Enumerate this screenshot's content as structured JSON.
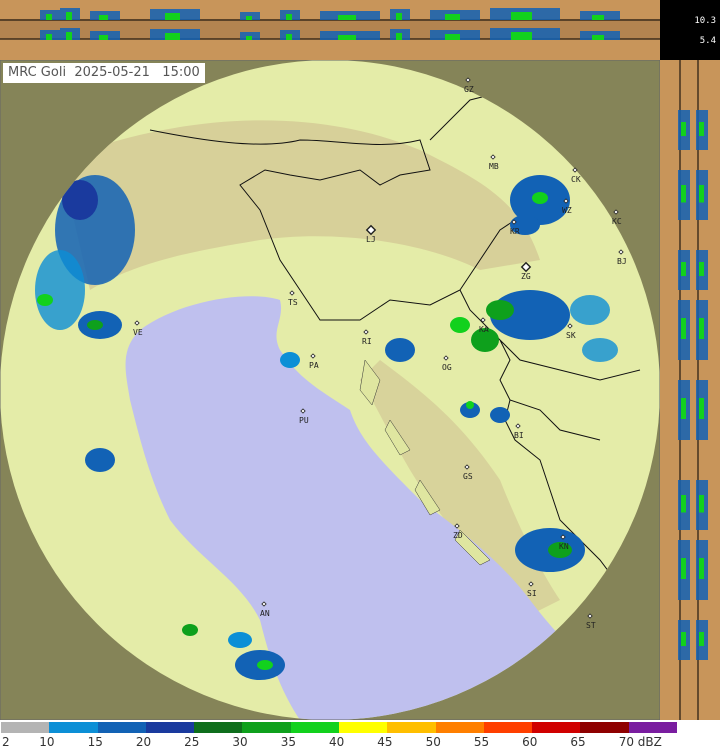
{
  "title": {
    "station": "MRC Goli",
    "date": "2025-05-21",
    "time": "15:00"
  },
  "corner_values": [
    "10.3",
    "5.4"
  ],
  "cities": [
    {
      "code": "GZ"
    },
    {
      "code": "MB"
    },
    {
      "code": "CK"
    },
    {
      "code": "WZ"
    },
    {
      "code": "KR"
    },
    {
      "code": "KC"
    },
    {
      "code": "LJ",
      "major": true
    },
    {
      "code": "BJ"
    },
    {
      "code": "ZG",
      "major": true
    },
    {
      "code": "TS"
    },
    {
      "code": "VE"
    },
    {
      "code": "RI"
    },
    {
      "code": "KA"
    },
    {
      "code": "SK"
    },
    {
      "code": "PA"
    },
    {
      "code": "OG"
    },
    {
      "code": "PU"
    },
    {
      "code": "BI"
    },
    {
      "code": "GS"
    },
    {
      "code": "ZD"
    },
    {
      "code": "KN"
    },
    {
      "code": "SI"
    },
    {
      "code": "AN"
    },
    {
      "code": "ST"
    }
  ],
  "legend": {
    "unit": "dBZ",
    "ticks": [
      "2",
      "10",
      "15",
      "20",
      "25",
      "30",
      "35",
      "40",
      "45",
      "50",
      "55",
      "60",
      "65",
      "70 dBZ"
    ],
    "colors": [
      "#b4b4b4",
      "#0c8fd6",
      "#1262b5",
      "#1a3a9e",
      "#0f6e1c",
      "#0ea01c",
      "#12d11d",
      "#ffff00",
      "#ffbf00",
      "#ff7f00",
      "#ff3f00",
      "#d00000",
      "#8e0000",
      "#7a1da0"
    ]
  }
}
